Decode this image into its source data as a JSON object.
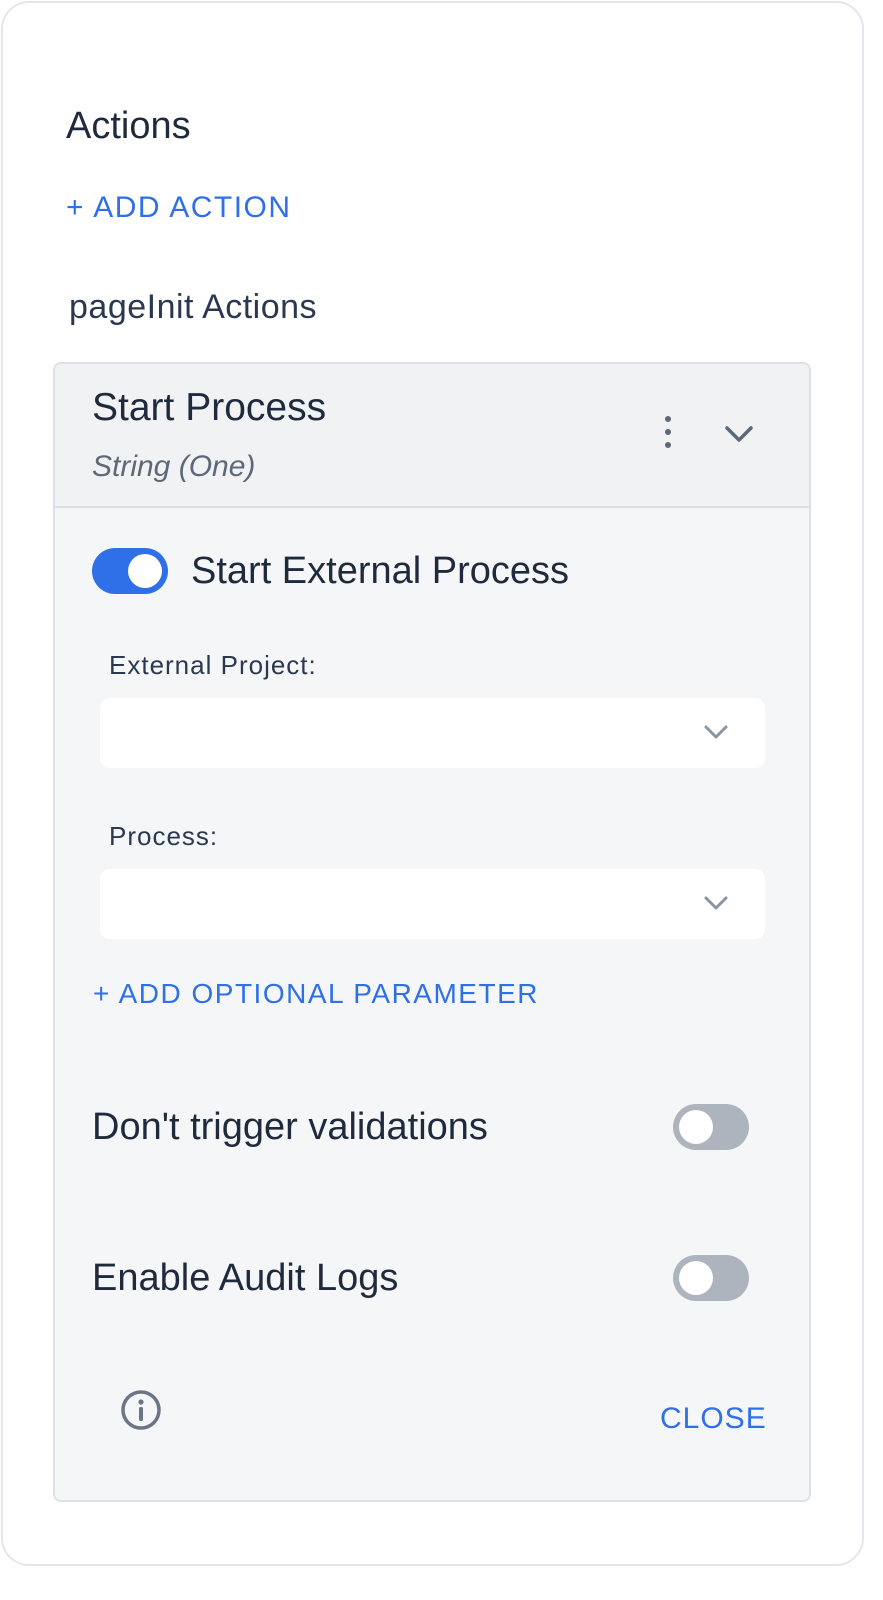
{
  "heading": "Actions",
  "add_action_label": "+ ADD ACTION",
  "section_title": "pageInit Actions",
  "action_card": {
    "title": "Start Process",
    "subtitle": "String (One)",
    "start_external": {
      "label": "Start External Process",
      "enabled": true
    },
    "external_project": {
      "label": "External Project:",
      "value": ""
    },
    "process": {
      "label": "Process:",
      "value": ""
    },
    "add_param_label": "+ ADD OPTIONAL PARAMETER",
    "dont_trigger_validations": {
      "label": "Don't trigger validations",
      "enabled": false
    },
    "enable_audit_logs": {
      "label": "Enable Audit Logs",
      "enabled": false
    },
    "close_label": "CLOSE"
  },
  "colors": {
    "accent": "#2f6fe8",
    "toggle_off": "#aeb4bd",
    "card_bg": "#f5f6f8",
    "text": "#1f2a3c"
  }
}
